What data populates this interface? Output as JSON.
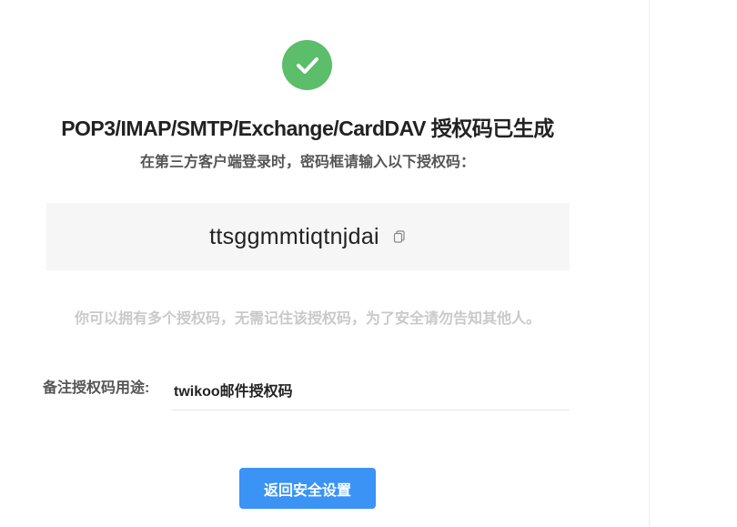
{
  "result": {
    "title": "POP3/IMAP/SMTP/Exchange/CardDAV 授权码已生成",
    "subtitle": "在第三方客户端登录时，密码框请输入以下授权码：",
    "auth_code": "ttsggmmtiqtnjdai",
    "hint": "你可以拥有多个授权码，无需记住该授权码，为了安全请勿告知其他人。"
  },
  "note": {
    "label": "备注授权码用途:",
    "value": "twikoo邮件授权码"
  },
  "actions": {
    "back_label": "返回安全设置"
  },
  "colors": {
    "success": "#5cbd6b",
    "primary": "#3a93f5",
    "hint": "#c9c9c9"
  },
  "icons": {
    "success": "check-circle-icon",
    "copy": "copy-icon"
  }
}
